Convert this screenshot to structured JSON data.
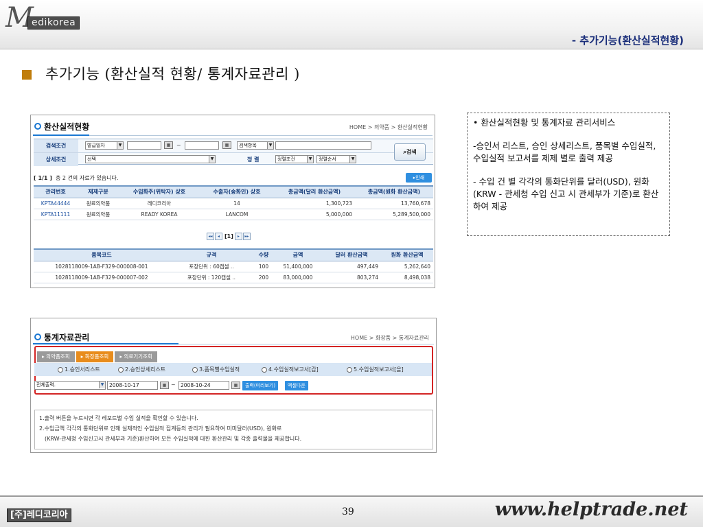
{
  "header": {
    "logo_m": "M",
    "logo_text": "edikorea",
    "subtitle": "- 추가기능(환산실적현황)"
  },
  "title": "추가기능 (환산실적 현황/ 통계자료관리 )",
  "panel1": {
    "title": "환산실적현황",
    "breadcrumb": "HOME > 의약품 > 환산실적현황",
    "search": {
      "row1_label": "검색조건",
      "row1_select": "발급일자",
      "tilde": "~",
      "item_select": "검색항목",
      "row2_label": "상세조건",
      "row2_select": "선택",
      "sort_label": "정  렬",
      "sort_select": "정렬조건",
      "order_select": "정렬순서",
      "button": "검색"
    },
    "page_info": "[ 1/1 ]",
    "count_text": "총 2 건의 자료가 있습니다.",
    "print_button": "▸인쇄",
    "table1": {
      "headers": [
        "관리번호",
        "제제구분",
        "수입화주(위탁자) 상호",
        "수출자(송화인) 상호",
        "총금액(달러 환산금액)",
        "총금액(원화 환산금액)"
      ],
      "rows": [
        [
          "KPTA44444",
          "원료의약품",
          "레디코리아",
          "14",
          "1,300,723",
          "13,760,678"
        ],
        [
          "KPTA11111",
          "원료의약품",
          "READY KOREA",
          "LANCOM",
          "5,000,000",
          "5,289,500,000"
        ]
      ]
    },
    "pager": {
      "first": "◂◂",
      "prev": "◂",
      "current": "[1]",
      "next": "▸",
      "last": "▸▸"
    },
    "table2": {
      "headers": [
        "품목코드",
        "규격",
        "수량",
        "금액",
        "달러 환산금액",
        "원화 환산금액"
      ],
      "rows": [
        [
          "1028118009-1AB-F329-000008-001",
          "포장단위 : 60캡셀 ..",
          "100",
          "51,400,000",
          "497,449",
          "5,262,640"
        ],
        [
          "1028118009-1AB-F329-000007-002",
          "포장단위 : 120캡셀 ..",
          "200",
          "83,000,000",
          "803,274",
          "8,498,038"
        ]
      ]
    }
  },
  "panel2": {
    "title": "통계자료관리",
    "breadcrumb": "HOME > 화장품 > 통계자료관리",
    "tabs": [
      "▸ 의약품조회",
      "▸ 화장품조회",
      "▸ 의료기기조회"
    ],
    "radios": [
      "1.승인서리스트",
      "2.승인상세리스트",
      "3.품목별수입실적",
      "4.수입실적보고서[갑]",
      "5.수입실적보고서[을]"
    ],
    "output_select": "전체출력.",
    "date_from": "2008-10-17",
    "tilde": "~",
    "date_to": "2008-10-24",
    "btn_print": "출력(미리보기)",
    "btn_excel": "엑셀다운",
    "notes": [
      "1.출력 버튼을 누르시면 각 레포트별 수입 실적을 확인할 수 있습니다.",
      "2.수입금액 각각의 통화단위로 인해 실제적인 수입실적 집계등의 관리가 필요하여 미미달러(USD), 원화로",
      "   (KRW-관세청 수입신고시 관세부과 기준)환산하여 모든 수입실적에 대한 환산관리 및 각종 출력물을 제공합니다."
    ]
  },
  "sidebox": [
    "• 환산실적현황 및 통계자료 관리서비스",
    "-승인서 리스트, 승인 상세리스트, 품목별 수입실적, 수입실적 보고서를 제제 별로 출력 제공",
    "- 수입 건 별 각각의 통화단위를 달러(USD), 원화(KRW - 관세청 수입 신고 시 관세부가 기준)로 환산하여 제공"
  ],
  "footer": {
    "logo": "[주]레디코리아",
    "page_number": "39",
    "site": "www.helptrade.net"
  },
  "colors": {
    "accent_blue": "#2f8fe0",
    "tab_active": "#e88c1c",
    "highlight_red": "#d32424",
    "title_bullet": "#c07d0c"
  }
}
